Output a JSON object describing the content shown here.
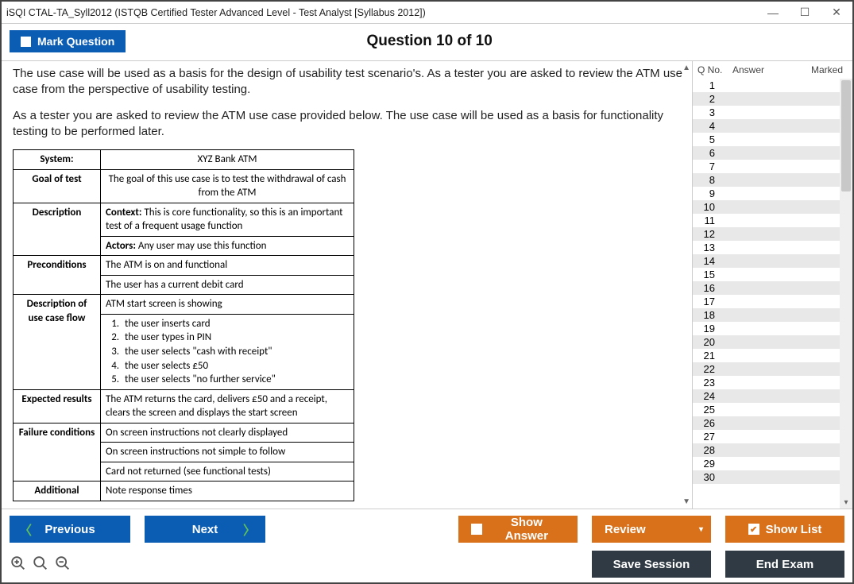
{
  "window": {
    "title": "iSQI CTAL-TA_Syll2012 (ISTQB Certified Tester Advanced Level - Test Analyst [Syllabus 2012])"
  },
  "topbar": {
    "mark_label": "Mark Question",
    "heading": "Question 10 of 10"
  },
  "question": {
    "para1": "The use case will be used as a basis for the design of usability test scenario's. As a tester you are asked to review the ATM use case from the perspective of usability testing.",
    "para2": "As a tester you are asked to review the ATM use case provided below. The use case will be used as a basis for functionality testing to be performed later."
  },
  "usecase": {
    "system_label": "System:",
    "system_value": "XYZ Bank ATM",
    "goal_label": "Goal of test",
    "goal_value": "The goal of this use case is to test the withdrawal of cash from the ATM",
    "desc_label": "Description",
    "desc_context": "Context: This is core functionality, so this is an important test of a frequent usage function",
    "desc_actors": "Actors: Any user may use this function",
    "precond_label": "Preconditions",
    "precond_1": "The ATM is on and functional",
    "precond_2": "The user has a current debit card",
    "flow_label": "Description of use case flow",
    "flow_intro": "ATM start screen is showing",
    "flow_1": "the user inserts card",
    "flow_2": "the user types in PIN",
    "flow_3": "the user selects \"cash with receipt\"",
    "flow_4": "the user selects £50",
    "flow_5": "the user selects \"no further service\"",
    "expect_label": "Expected results",
    "expect_value": "The ATM returns the card, delivers £50 and a receipt, clears the screen and displays the start screen",
    "fail_label": "Failure conditions",
    "fail_1": "On screen instructions not clearly displayed",
    "fail_2": "On screen instructions not simple to follow",
    "fail_3": "Card not returned (see functional tests)",
    "add_label": "Additional",
    "add_value": "Note response times"
  },
  "sidebar": {
    "h1": "Q No.",
    "h2": "Answer",
    "h3": "Marked",
    "rows": 30
  },
  "buttons": {
    "previous": "Previous",
    "next": "Next",
    "show_answer": "Show Answer",
    "review": "Review",
    "show_list": "Show List",
    "save_session": "Save Session",
    "end_exam": "End Exam"
  }
}
